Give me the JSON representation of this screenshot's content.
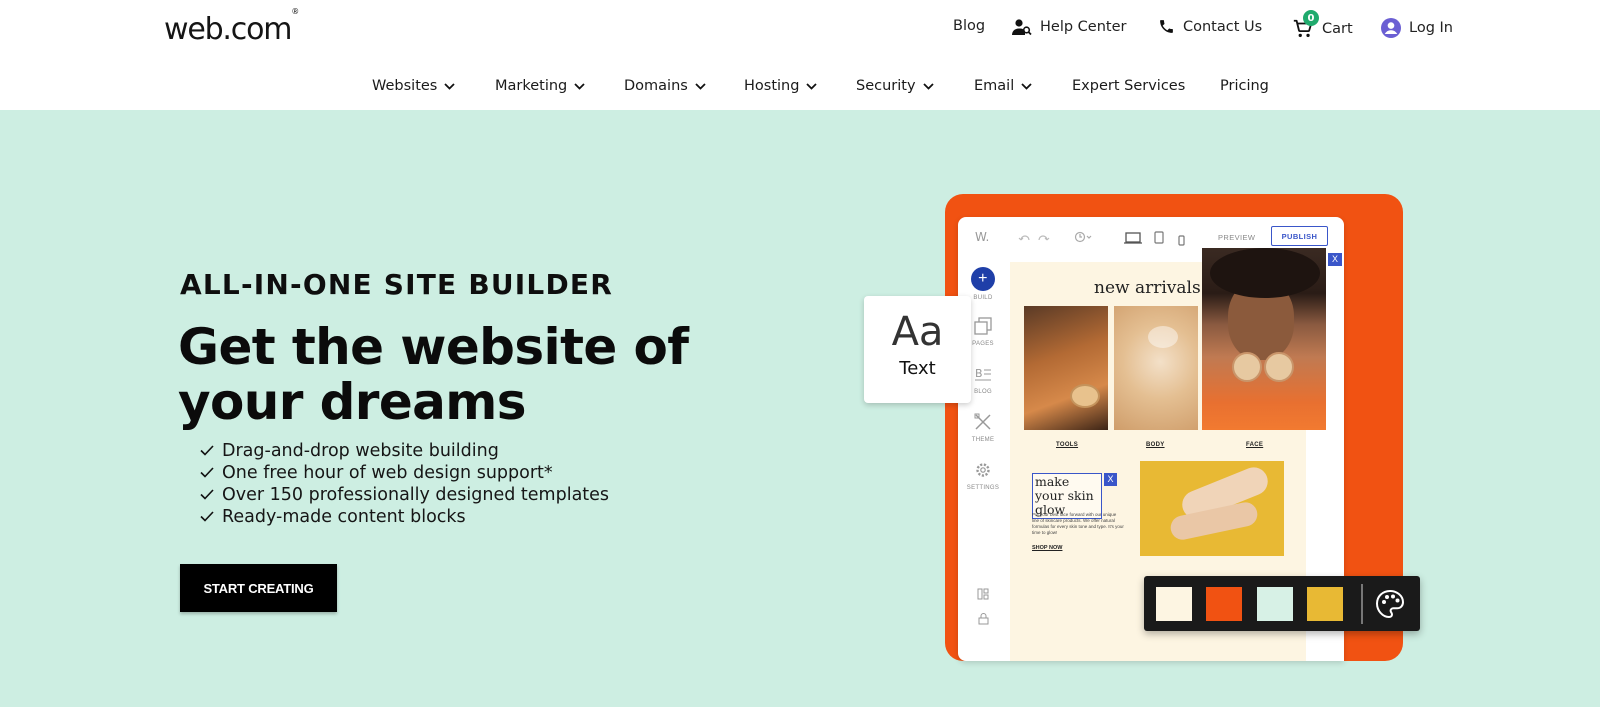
{
  "header": {
    "logo": "web.com",
    "logo_mark": "®",
    "utility": {
      "blog": "Blog",
      "help_center": "Help Center",
      "contact_us": "Contact Us",
      "cart": "Cart",
      "cart_count": "0",
      "log_in": "Log In"
    },
    "nav": [
      "Websites",
      "Marketing",
      "Domains",
      "Hosting",
      "Security",
      "Email",
      "Expert Services",
      "Pricing"
    ]
  },
  "hero": {
    "eyebrow": "ALL-IN-ONE SITE BUILDER",
    "headline": "Get the website of your dreams",
    "features": [
      "Drag-and-drop website building",
      "One free hour of web design support*",
      "Over 150 professionally designed templates",
      "Ready-made content blocks"
    ],
    "cta": "START CREATING"
  },
  "builder_mock": {
    "logo": "W.",
    "preview": "PREVIEW",
    "publish": "PUBLISH",
    "side_tools": [
      "BUILD",
      "PAGES",
      "BLOG",
      "THEME",
      "SETTINGS"
    ],
    "heading": "new arrivals",
    "categories": [
      "TOOLS",
      "BODY",
      "FACE"
    ],
    "promo_title": "make your skin glow",
    "promo_body": "Put your best face forward with our unique line of skincare products. We offer natural formulas for every skin tone and type. It's your time to glow!",
    "shop_now": "SHOP NOW",
    "close_x": "X",
    "text_card_glyph": "Aa",
    "text_card_label": "Text",
    "palette_colors": [
      "#fdf5e2",
      "#f15212",
      "#d7f1e6",
      "#e8b934"
    ]
  },
  "colors": {
    "hero_bg": "#cdeee2",
    "brand_orange": "#f15212",
    "cart_badge": "#1faa6d",
    "login_icon": "#6b5fd3",
    "publish_blue": "#3a56c9"
  }
}
